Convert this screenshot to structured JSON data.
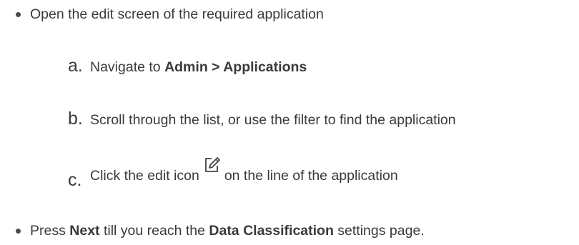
{
  "steps": {
    "step1": {
      "text": "Open the edit screen of the required application"
    },
    "substeps": {
      "a": {
        "letter": "a.",
        "prefix": "Navigate to ",
        "bold": "Admin > Applications"
      },
      "b": {
        "letter": "b.",
        "text": "Scroll through the list, or use the filter to find the application"
      },
      "c": {
        "letter": "c.",
        "prefix": "Click the edit icon",
        "icon": "edit-icon",
        "suffix": "on the line of the application"
      }
    },
    "step2": {
      "prefix": "Press ",
      "bold1": "Next",
      "middle": " till you reach the ",
      "bold2": "Data Classification",
      "suffix": " settings page."
    }
  }
}
